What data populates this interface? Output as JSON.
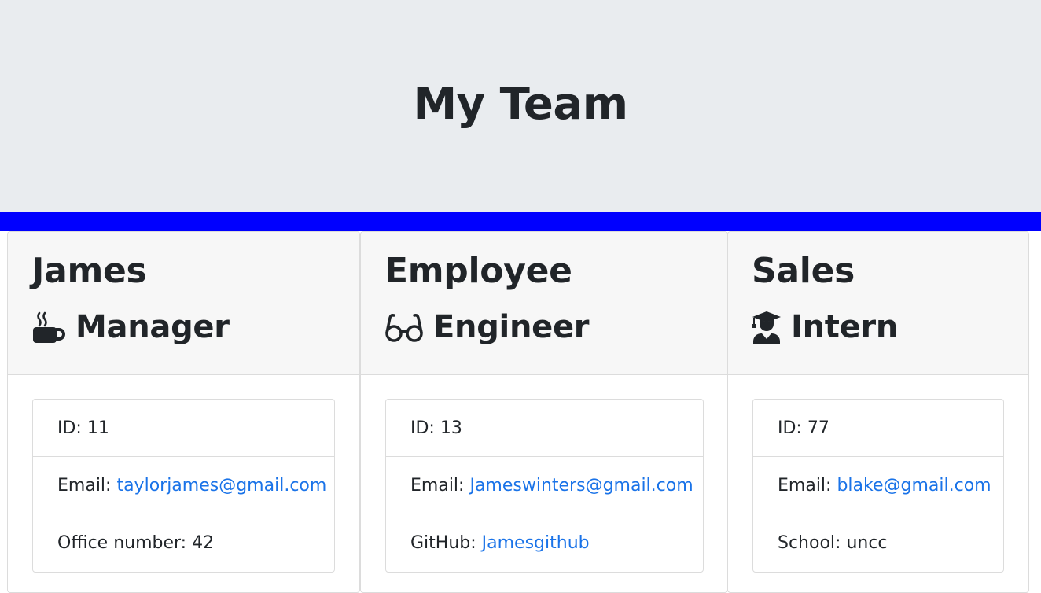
{
  "header": {
    "title": "My Team"
  },
  "colors": {
    "banner": "#0000ff",
    "link": "#1a73e8",
    "header_bg": "#e9ecef"
  },
  "cards": [
    {
      "name": "James",
      "role": "Manager",
      "role_icon": "coffee-icon",
      "id_label": "ID:",
      "id_value": "11",
      "email_label": "Email:",
      "email_value": "taylorjames@gmail.com",
      "extra_label": "Office number:",
      "extra_value": "42"
    },
    {
      "name": "Employee",
      "role": "Engineer",
      "role_icon": "glasses-icon",
      "id_label": "ID:",
      "id_value": "13",
      "email_label": "Email:",
      "email_value": "Jameswinters@gmail.com",
      "extra_label": "GitHub:",
      "extra_value": "Jamesgithub"
    },
    {
      "name": "Sales",
      "role": "Intern",
      "role_icon": "graduate-icon",
      "id_label": "ID:",
      "id_value": "77",
      "email_label": "Email:",
      "email_value": "blake@gmail.com",
      "extra_label": "School:",
      "extra_value": "uncc"
    }
  ]
}
